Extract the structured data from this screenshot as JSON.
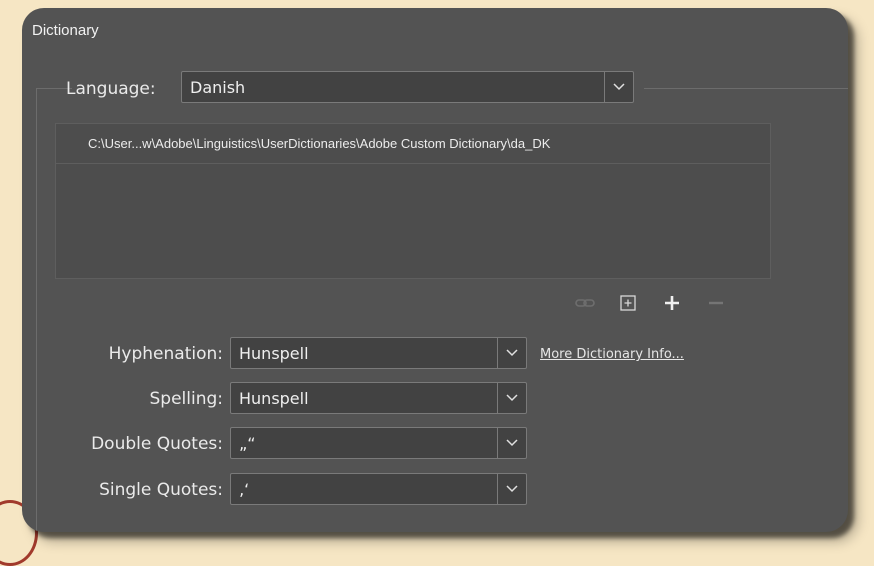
{
  "panel": {
    "title": "Dictionary"
  },
  "language": {
    "label": "Language:",
    "value": "Danish"
  },
  "dictionaries": {
    "items": [
      "C:\\User...w\\Adobe\\Linguistics\\UserDictionaries\\Adobe Custom Dictionary\\da_DK"
    ]
  },
  "toolbar": {
    "icons": [
      "link-icon",
      "new-dictionary-icon",
      "add-icon",
      "remove-icon"
    ]
  },
  "hyphenation": {
    "label": "Hyphenation:",
    "value": "Hunspell"
  },
  "more_info_link": "More Dictionary Info...",
  "spelling": {
    "label": "Spelling:",
    "value": "Hunspell"
  },
  "double_quotes": {
    "label": "Double Quotes:",
    "value": "„“"
  },
  "single_quotes": {
    "label": "Single Quotes:",
    "value": "‚‘"
  },
  "colors": {
    "panel": "#535353",
    "background": "#f6e6c4",
    "field": "#424242"
  }
}
